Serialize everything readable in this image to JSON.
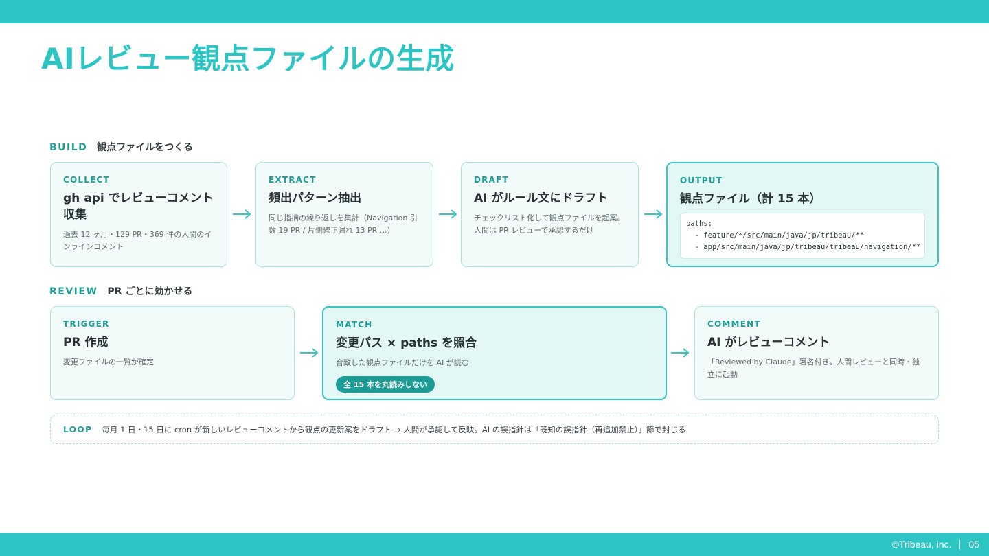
{
  "title": "AIレビュー観点ファイルの生成",
  "build": {
    "key": "BUILD",
    "desc": "観点ファイルをつくる",
    "cards": [
      {
        "tag": "COLLECT",
        "title": "gh api でレビューコメント収集",
        "desc": "過去 12 ヶ月・129 PR・369 件の人間のインラインコメント"
      },
      {
        "tag": "EXTRACT",
        "title": "頻出パターン抽出",
        "desc": "同じ指摘の繰り返しを集計（Navigation 引数 19 PR / 片側修正漏れ 13 PR …）"
      },
      {
        "tag": "DRAFT",
        "title": "AI がルール文にドラフト",
        "desc": "チェックリスト化して観点ファイルを起案。人間は PR レビューで承認するだけ"
      },
      {
        "tag": "OUTPUT",
        "title": "観点ファイル（計 15 本）",
        "code": "paths:\n  - feature/*/src/main/java/jp/tribeau/**\n  - app/src/main/java/jp/tribeau/tribeau/navigation/**"
      }
    ]
  },
  "review": {
    "key": "REVIEW",
    "desc": "PR ごとに効かせる",
    "cards": [
      {
        "tag": "TRIGGER",
        "title": "PR 作成",
        "desc": "変更ファイルの一覧が確定"
      },
      {
        "tag": "MATCH",
        "title": "変更パス × paths を照合",
        "desc": "合致した観点ファイルだけを AI が読む",
        "badge": "全 15 本を丸読みしない"
      },
      {
        "tag": "COMMENT",
        "title": "AI がレビューコメント",
        "desc": "「Reviewed by Claude」署名付き。人間レビューと同時・独立に起動"
      }
    ]
  },
  "loop": {
    "key": "LOOP",
    "text": "毎月 1 日・15 日に cron が新しいレビューコメントから観点の更新案をドラフト → 人間が承認して反映。AI の誤指針は「既知の誤指針（再追加禁止）」節で封じる"
  },
  "footer": {
    "copyright": "©Tribeau, inc.",
    "page": "05"
  },
  "colors": {
    "accent": "#2cc5c3",
    "label": "#1f9e9a",
    "card_border": "#a8e3e0",
    "card_bg": "#f1fbfa",
    "highlight_bg": "#e3f7f5"
  }
}
